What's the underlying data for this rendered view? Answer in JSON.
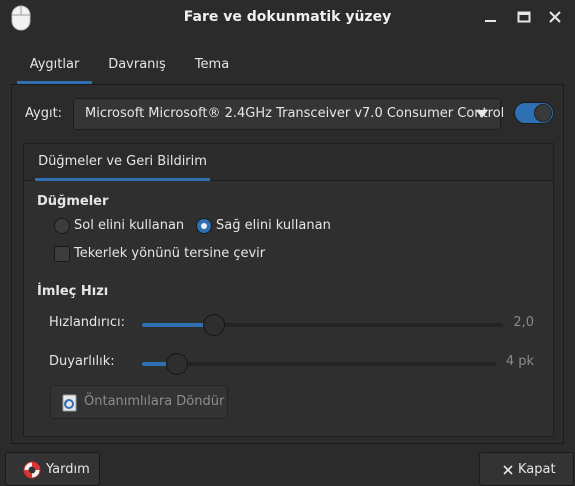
{
  "window": {
    "title": "Fare ve dokunmatik yüzey",
    "icon": "mouse-icon",
    "controls": [
      "minimize-icon",
      "maximize-icon",
      "close-icon"
    ]
  },
  "tabs": [
    {
      "label": "Aygıtlar",
      "active": true
    },
    {
      "label": "Davranış",
      "active": false
    },
    {
      "label": "Tema",
      "active": false
    }
  ],
  "device": {
    "label": "Aygıt:",
    "selected": "Microsoft Microsoft® 2.4GHz Transceiver v7.0 Consumer Control",
    "enabled": true
  },
  "inner_tab": {
    "label": "Düğmeler ve Geri Bildirim"
  },
  "buttons_section": {
    "title": "Düğmeler",
    "left_hand": {
      "label": "Sol elini kullanan",
      "checked": false
    },
    "right_hand": {
      "label": "Sağ elini kullanan",
      "checked": true
    },
    "reverse_scroll": {
      "label": "Tekerlek yönünü tersine çevir",
      "checked": false
    }
  },
  "pointer_section": {
    "title": "İmleç Hızı",
    "acceleration": {
      "label": "Hızlandırıcı:",
      "value_text": "2,0",
      "fraction": 0.2
    },
    "sensitivity": {
      "label": "Duyarlılık:",
      "value_text": "4 pk",
      "fraction": 0.1
    },
    "reset_label": "Öntanımlılara Döndür"
  },
  "footer": {
    "help_label": "Yardım",
    "close_label": "Kapat"
  },
  "colors": {
    "accent": "#2f6fb3",
    "background": "#2b2b2b",
    "text": "#e6e6e6"
  }
}
